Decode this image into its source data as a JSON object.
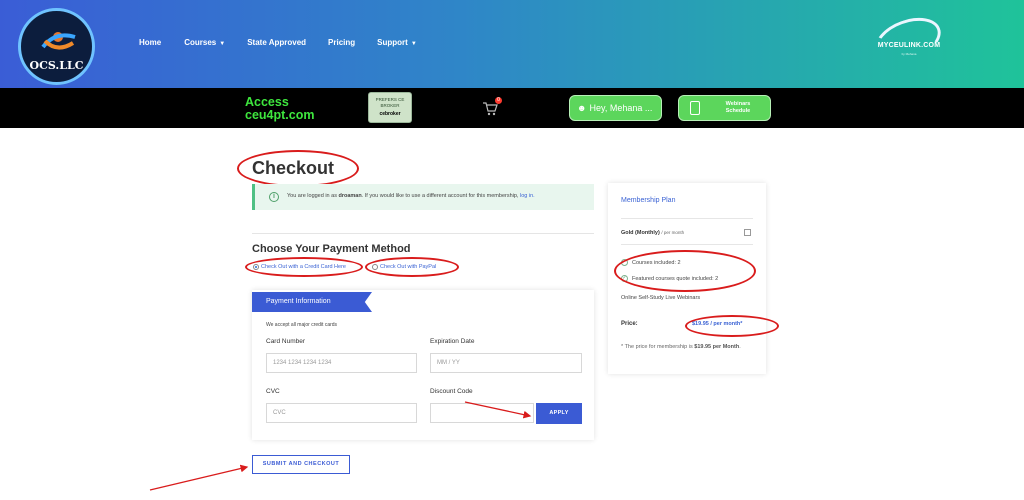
{
  "header": {
    "logo_text": "OCS.LLC",
    "nav": [
      {
        "label": "Home",
        "has_dropdown": false
      },
      {
        "label": "Courses",
        "has_dropdown": true
      },
      {
        "label": "State Approved",
        "has_dropdown": false
      },
      {
        "label": "Pricing",
        "has_dropdown": false
      },
      {
        "label": "Support",
        "has_dropdown": true
      }
    ],
    "brand_right": "MYCEULINK.COM",
    "brand_right_sub": "by Mehana"
  },
  "topbar": {
    "access_line1": "Access",
    "access_line2": "ceu4pt.com",
    "badge_text": "PREFERS CE BROKER",
    "badge_brand": "cebroker",
    "cart_count": "0",
    "user_greeting": "Hey, Mehana ...",
    "webinar_line1": "Webinars",
    "webinar_line2": "Schedule"
  },
  "checkout": {
    "title": "Checkout",
    "notice_prefix": "You are logged in as",
    "notice_user": "droaman",
    "notice_suffix": ". If you would like to use a different account for this membership,",
    "notice_link": "log in.",
    "payment_method_title": "Choose Your Payment Method",
    "options": [
      {
        "label": "Check Out with a Credit Card Here",
        "selected": true
      },
      {
        "label": "Check Out with PayPal",
        "selected": false
      }
    ],
    "payment_info": {
      "title": "Payment Information",
      "accept_text": "We accept all major credit cards",
      "card_number_label": "Card Number",
      "card_number_placeholder": "1234 1234 1234 1234",
      "expiration_label": "Expiration Date",
      "expiration_placeholder": "MM / YY",
      "cvc_label": "CVC",
      "cvc_placeholder": "CVC",
      "discount_label": "Discount Code",
      "discount_value": "",
      "apply_label": "APPLY"
    },
    "submit_label": "SUBMIT AND CHECKOUT"
  },
  "membership": {
    "title": "Membership Plan",
    "plan_name": "Gold (Monthly)",
    "plan_period": "/ per month",
    "features": [
      "Courses included: 2",
      "Featured courses quote included: 2"
    ],
    "online_text": "Online Self-Study Live Webinars",
    "price_label": "Price:",
    "price_value": "$19.95 / per month*",
    "note_prefix": "* The price for membership is",
    "note_amount": "$19.95 per Month",
    "note_suffix": "."
  },
  "colors": {
    "accent_blue": "#3b5bd4",
    "annotation_red": "#d91c1c",
    "bright_green": "#5cd65c"
  }
}
